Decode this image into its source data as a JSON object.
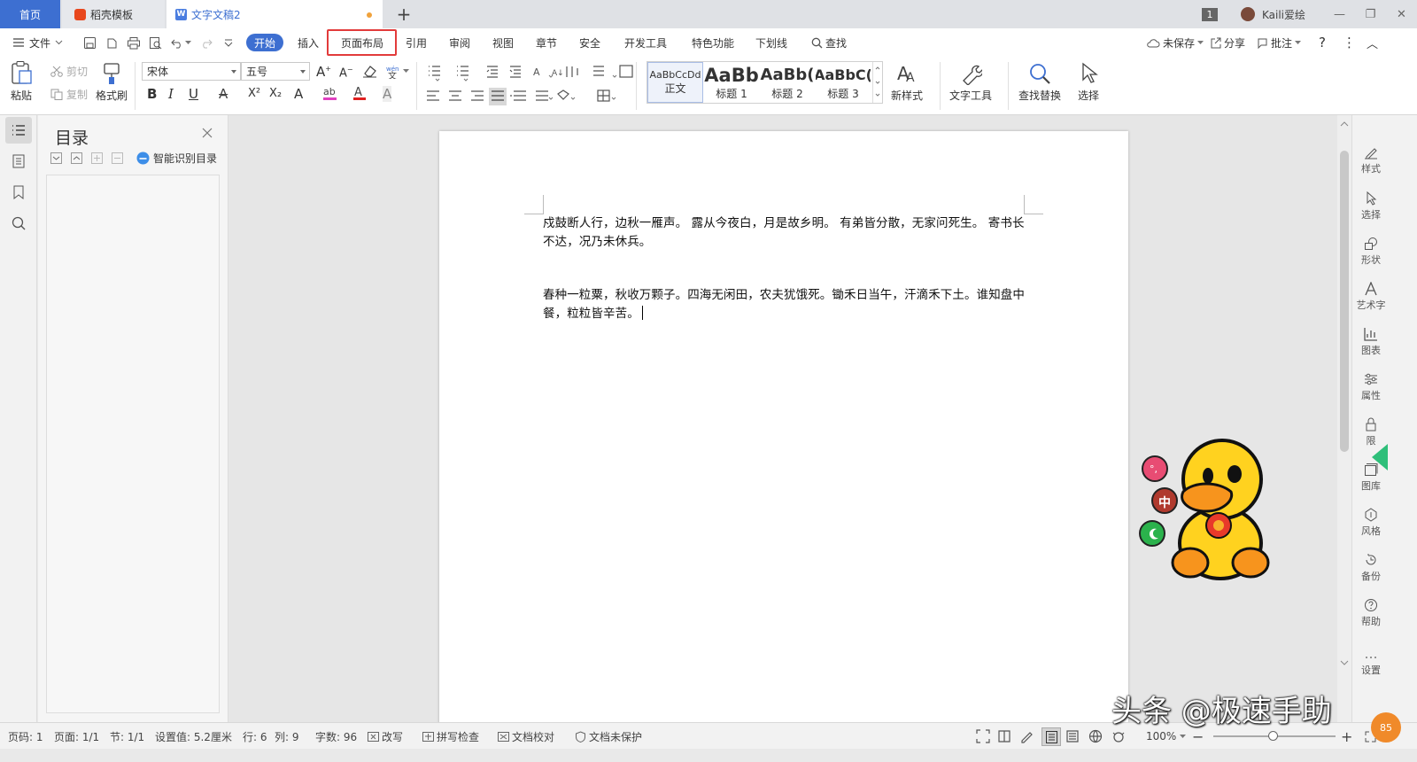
{
  "tabs": {
    "home": "首页",
    "daoke": "稻壳模板",
    "doc": "文字文稿2",
    "add": "+"
  },
  "window": {
    "page_count": "1",
    "user": "Kaili爱绘",
    "minimize": "—",
    "restore": "❐",
    "close": "✕"
  },
  "menu": {
    "file": "文件",
    "start": "开始",
    "insert": "插入",
    "page_layout": "页面布局",
    "reference": "引用",
    "review": "审阅",
    "view": "视图",
    "chapter": "章节",
    "security": "安全",
    "dev_tools": "开发工具",
    "special": "特色功能",
    "underline": "下划线",
    "find": "查找",
    "unsaved": "未保存",
    "share": "分享",
    "comment": "批注",
    "help": "?",
    "more": "⋮",
    "collapse": "︿"
  },
  "ribbon": {
    "paste": "粘贴",
    "cut": "剪切",
    "copy": "复制",
    "format_painter": "格式刷",
    "font_name": "宋体",
    "font_size": "五号",
    "bold": "B",
    "italic": "I",
    "underline": "U",
    "strike": "A",
    "superscript": "X²",
    "subscript": "X₂",
    "new_style": "新样式",
    "text_tools": "文字工具",
    "find_replace": "查找替换",
    "select": "选择"
  },
  "styles": [
    {
      "preview": "AaBbCcDd",
      "name": "正文"
    },
    {
      "preview": "AaBb",
      "name": "标题 1"
    },
    {
      "preview": "AaBb(",
      "name": "标题 2"
    },
    {
      "preview": "AaBbC(",
      "name": "标题 3"
    }
  ],
  "toc": {
    "title": "目录",
    "smart": "智能识别目录"
  },
  "document": {
    "para1": "戍鼓断人行，边秋一雁声。 露从今夜白，月是故乡明。 有弟皆分散，无家问死生。 寄书长不达，况乃未休兵。",
    "para2": "春种一粒粟，秋收万颗子。四海无闲田，农夫犹饿死。锄禾日当午，汗滴禾下土。谁知盘中餐，粒粒皆辛苦。"
  },
  "right_panel": [
    "样式",
    "选择",
    "形状",
    "艺术字",
    "图表",
    "属性",
    "限",
    "图库",
    "风格",
    "备份",
    "帮助",
    "设置"
  ],
  "status": {
    "page_no": "页码: 1",
    "pages": "页面: 1/1",
    "section": "节: 1/1",
    "setting": "设置值: 5.2厘米",
    "row": "行: 6",
    "col": "列: 9",
    "words": "字数: 96",
    "revise": "改写",
    "spell": "拼写检查",
    "proof": "文档校对",
    "protect": "文档未保护",
    "zoom": "100%",
    "zoom_minus": "−",
    "zoom_plus": "+"
  },
  "floating": {
    "ime_label": "中",
    "badge": "85"
  },
  "watermark": "头条 @极速手助",
  "colors": {
    "accent": "#3d6fd1",
    "highlight_box": "#e23b3b",
    "font_color": "#e02020",
    "highlight_color": "#e040c0"
  }
}
